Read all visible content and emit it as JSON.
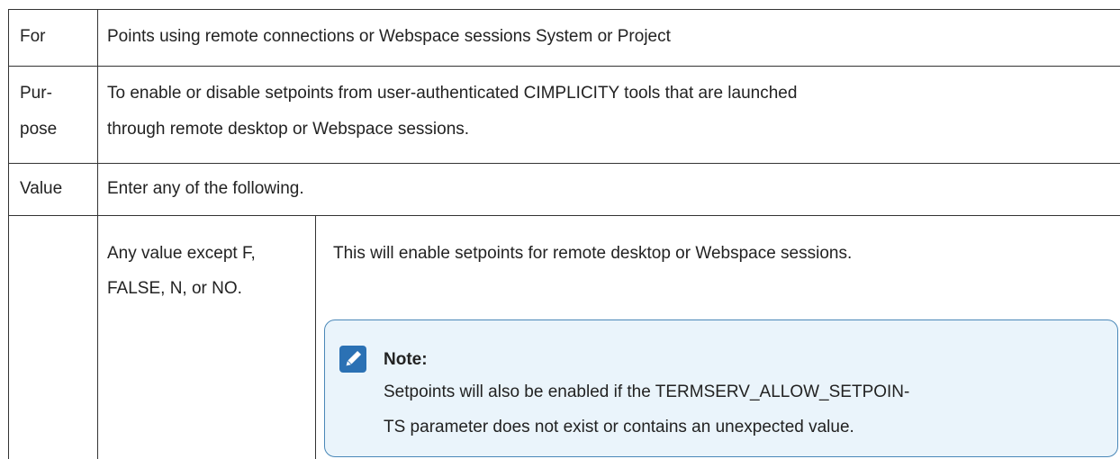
{
  "rows": {
    "for": {
      "label": "For",
      "value": "Points using remote connections or Webspace sessions System or Project"
    },
    "purpose": {
      "label_lines": [
        "Pur-",
        "pose"
      ],
      "value_lines": [
        "To enable or disable setpoints from user-authenticated CIMPLICITY tools that are launched",
        "through remote desktop or Webspace sessions."
      ]
    },
    "value": {
      "label": "Value",
      "intro": "Enter any of the following."
    }
  },
  "option": {
    "value_lines": [
      "Any value except F,",
      "FALSE, N, or NO."
    ],
    "description": "This will enable setpoints for remote desktop or Webspace sessions."
  },
  "note": {
    "icon": "pencil-icon",
    "title": "Note:",
    "lines": [
      "Setpoints will also be enabled if the TERMSERV_ALLOW_SETPOIN-",
      "TS parameter does not exist or contains an unexpected value."
    ],
    "accent_color": "#2b71b4",
    "background_color": "#eaf4fb",
    "border_color": "#4a88b8"
  }
}
